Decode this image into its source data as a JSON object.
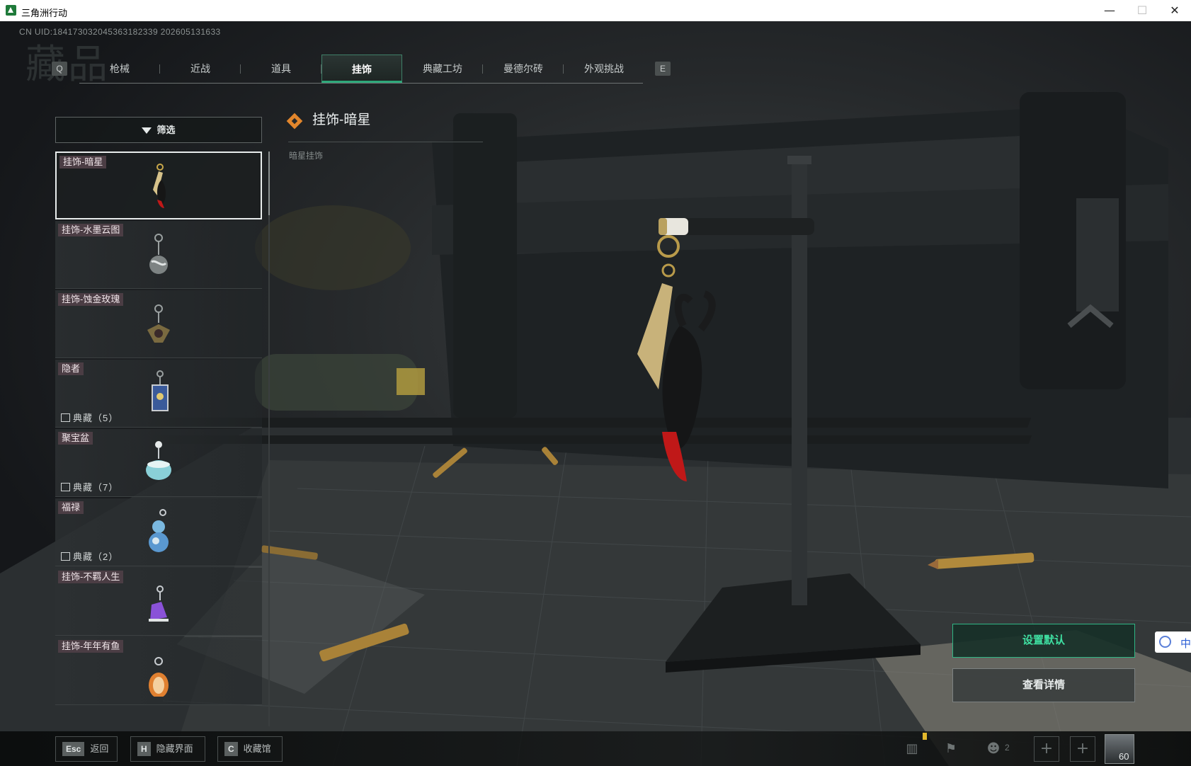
{
  "window": {
    "title": "三角洲行动",
    "controls": [
      "—",
      "☐",
      "✕"
    ]
  },
  "header": {
    "uid": "CN UID:184173032045363182339 202605131633",
    "ghost_title": "藏品",
    "key_prev": "Q",
    "key_next": "E"
  },
  "tabs": [
    {
      "label": "枪械",
      "active": false
    },
    {
      "label": "近战",
      "active": false
    },
    {
      "label": "道具",
      "active": false
    },
    {
      "label": "挂饰",
      "active": true
    },
    {
      "label": "典藏工坊",
      "active": false
    },
    {
      "label": "曼德尔砖",
      "active": false
    },
    {
      "label": "外观挑战",
      "active": false
    }
  ],
  "filter": {
    "label": "筛选"
  },
  "items": [
    {
      "name": "挂饰-暗星",
      "collection": "",
      "selected": true,
      "thumb": "demon-charm"
    },
    {
      "name": "挂饰-水墨云图",
      "collection": "",
      "selected": false,
      "thumb": "ball-charm"
    },
    {
      "name": "挂饰-蚀金玫瑰",
      "collection": "",
      "selected": false,
      "thumb": "rose-charm"
    },
    {
      "name": "隐者",
      "collection": "典藏（5）",
      "selected": false,
      "thumb": "card-charm"
    },
    {
      "name": "聚宝盆",
      "collection": "典藏（7）",
      "selected": false,
      "thumb": "pot-charm"
    },
    {
      "name": "福禄",
      "collection": "典藏（2）",
      "selected": false,
      "thumb": "gourd-charm"
    },
    {
      "name": "挂饰-不羁人生",
      "collection": "",
      "selected": false,
      "thumb": "shoe-charm"
    },
    {
      "name": "挂饰-年年有鱼",
      "collection": "",
      "selected": false,
      "thumb": "fish-charm"
    }
  ],
  "detail": {
    "title": "挂饰-暗星",
    "subtitle": "暗星挂饰",
    "icon": "diamond-icon",
    "accent": "#e2862c"
  },
  "actions": {
    "set_default": "设置默认",
    "view_details": "查看详情"
  },
  "ime": {
    "label": "中"
  },
  "bottom": {
    "back": {
      "key": "Esc",
      "label": "返回"
    },
    "hide_ui": {
      "key": "H",
      "label": "隐藏界面"
    },
    "collection": {
      "key": "C",
      "label": "收藏馆"
    },
    "friends_count": "2",
    "level": "60"
  },
  "colors": {
    "active_tab_border": "#2ea87a",
    "set_default_text": "#3fe0a2",
    "tag_background": "#4b3d44"
  }
}
